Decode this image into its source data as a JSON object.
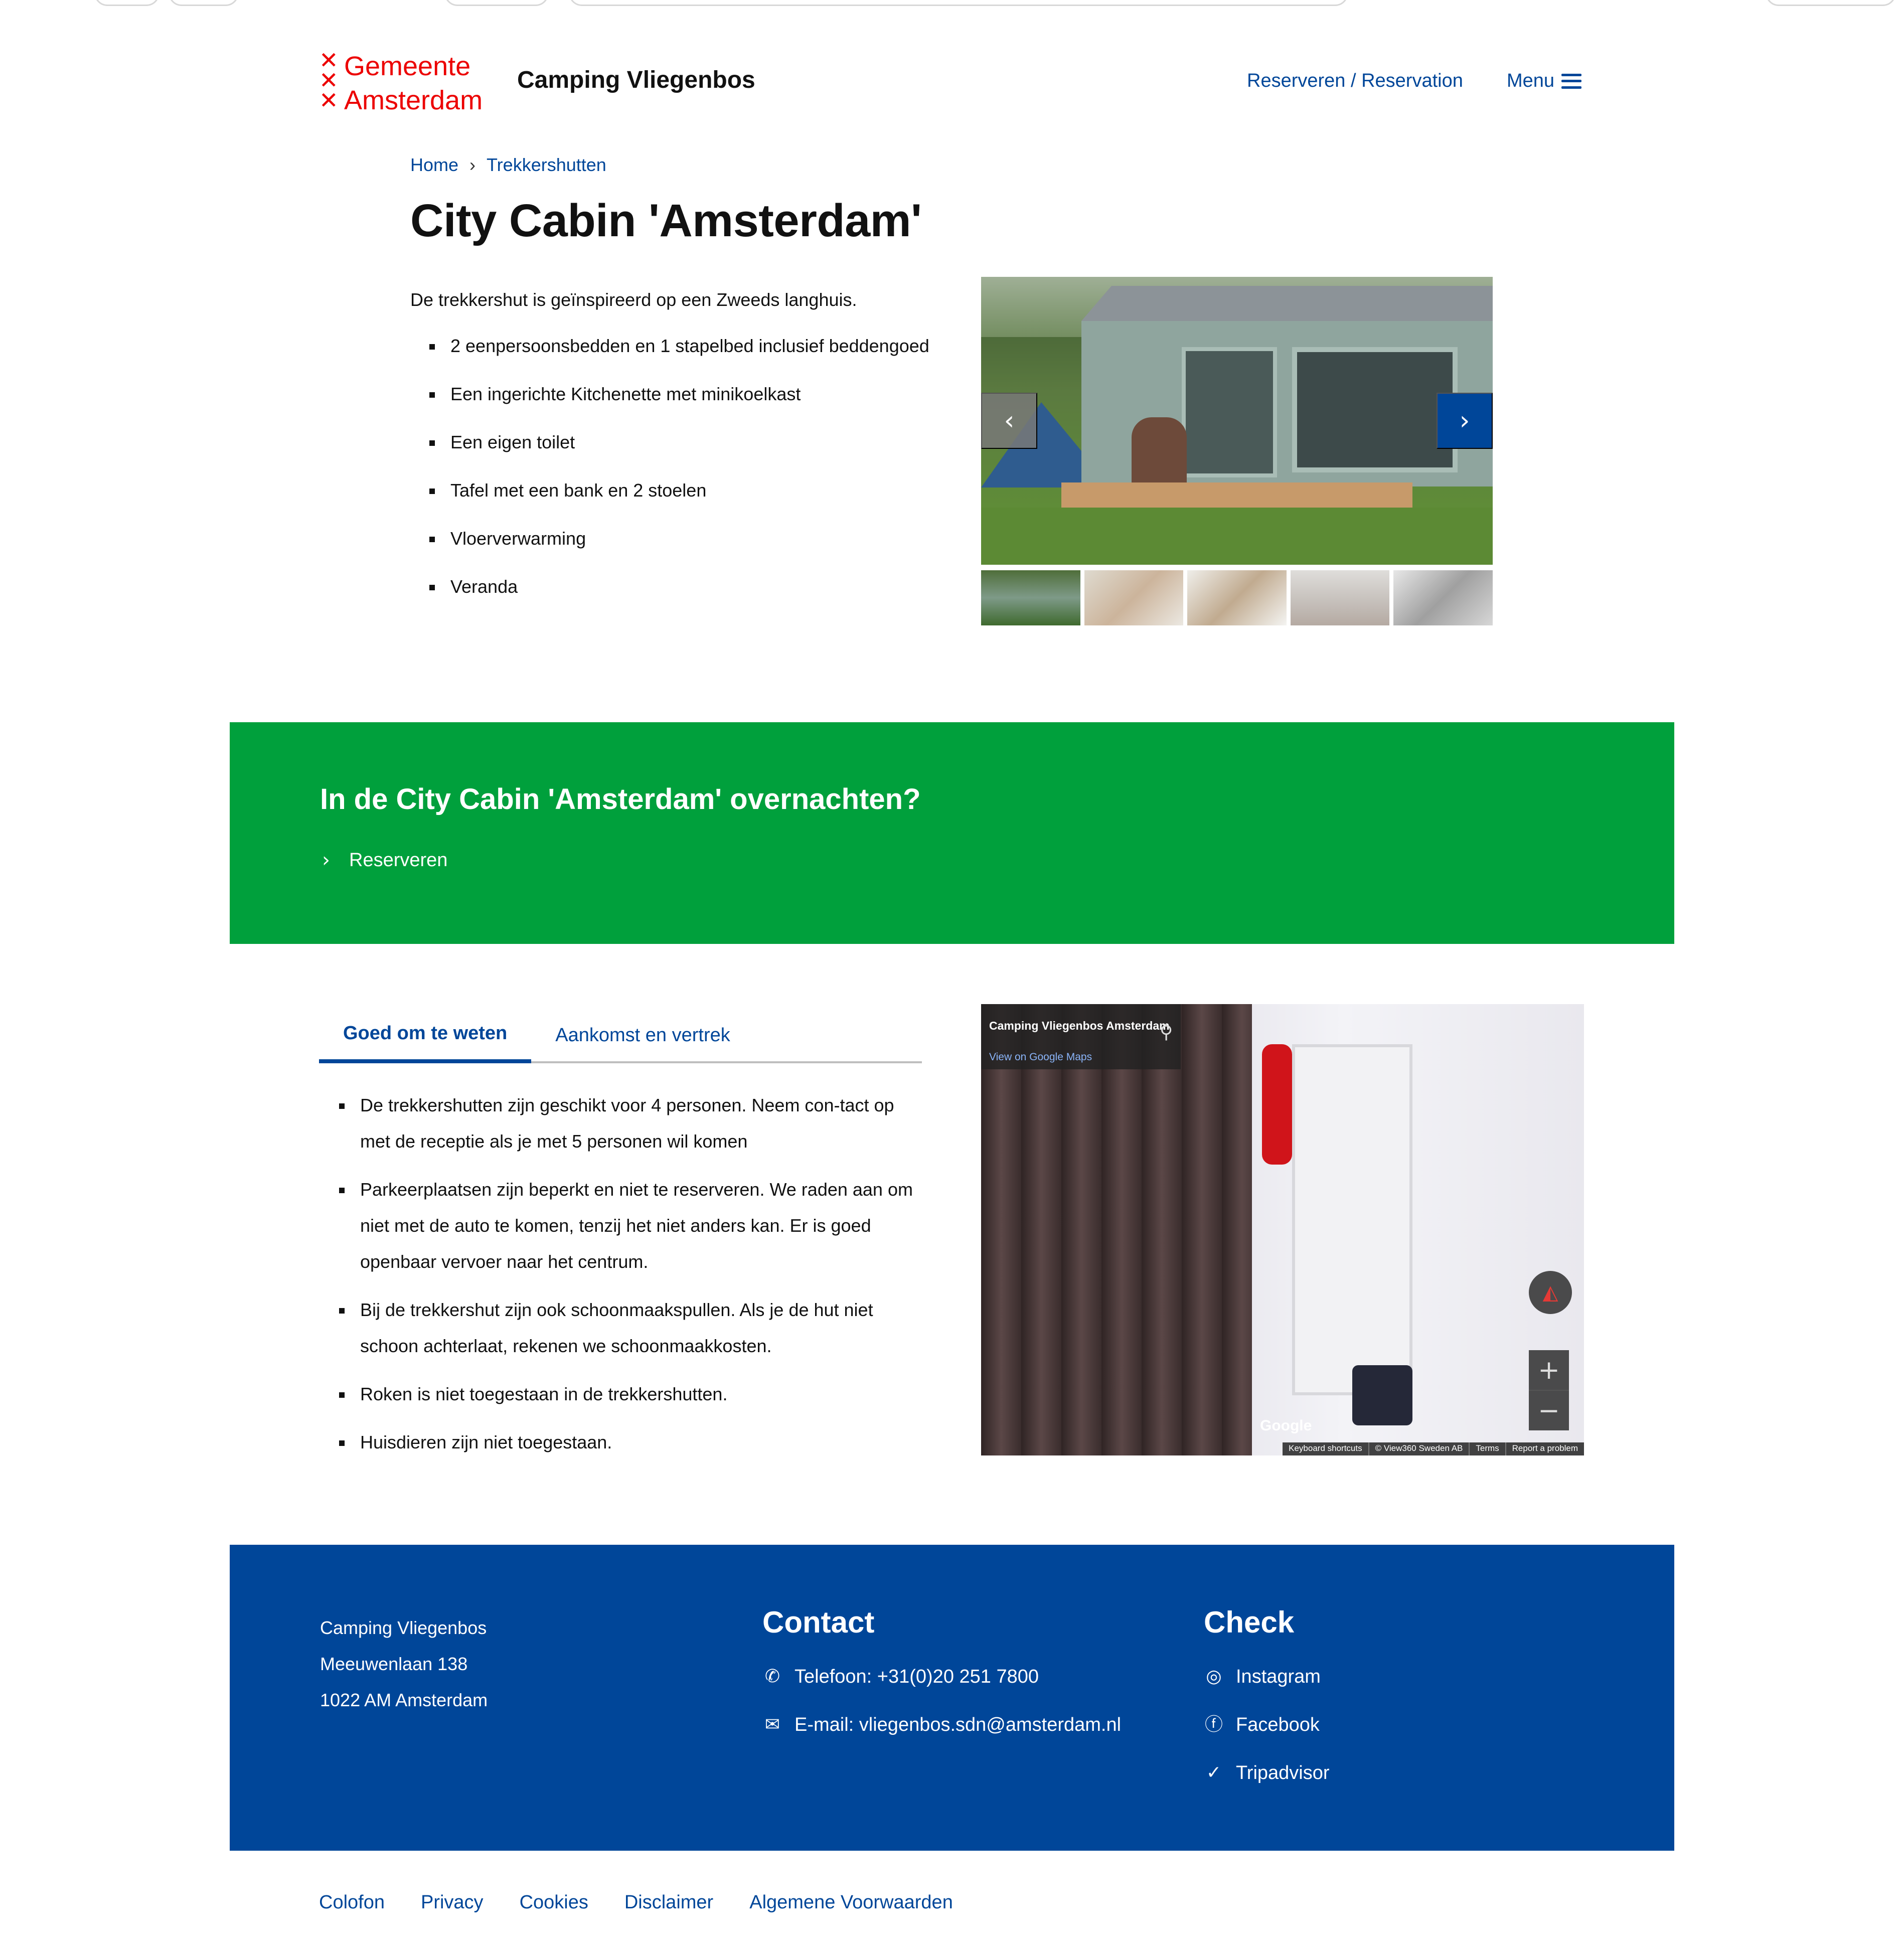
{
  "header": {
    "logo_text_line1": "Gemeente",
    "logo_text_line2": "Amsterdam",
    "site_name": "Camping Vliegenbos",
    "reserve_link": "Reserveren / Reservation",
    "menu_label": "Menu"
  },
  "breadcrumb": {
    "home": "Home",
    "separator": "›",
    "current": "Trekkershutten"
  },
  "page": {
    "title": "City Cabin 'Amsterdam'",
    "intro": "De trekkershut is geïnspireerd op een Zweeds langhuis.",
    "features": [
      "2 eenpersoonsbedden en 1 stapelbed inclusief beddengoed",
      "Een ingerichte Kitchenette met minikoelkast",
      "Een eigen toilet",
      "Tafel met een bank en 2 stoelen",
      "Vloerverwarming",
      "Veranda"
    ]
  },
  "carousel": {
    "prev_icon": "‹",
    "next_icon": "›"
  },
  "cta": {
    "heading": "In de City Cabin 'Amsterdam' overnachten?",
    "link_label": "Reserveren",
    "chevron": "›"
  },
  "tabs": {
    "items": [
      {
        "label": "Goed om te weten",
        "active": true
      },
      {
        "label": "Aankomst en vertrek",
        "active": false
      }
    ],
    "content": [
      "De trekkershutten zijn geschikt voor 4 personen. Neem con-tact op met de receptie als je met 5 personen wil komen",
      "Parkeerplaatsen zijn beperkt en niet te reserveren. We raden aan om niet met de auto te komen, tenzij het niet anders kan. Er is goed openbaar vervoer naar het centrum.",
      "Bij de trekkershut zijn ook schoonmaakspullen. Als je de hut niet schoon achterlaat, rekenen we schoonmaakkosten.",
      "Roken is niet toegestaan in de trekkershutten.",
      "Huisdieren zijn niet toegestaan."
    ]
  },
  "streetview": {
    "title": "Camping Vliegenbos Amsterdam",
    "maps_link": "View on Google Maps",
    "google_label": "Google",
    "zoom_in": "+",
    "zoom_out": "−",
    "attribution": [
      "Keyboard shortcuts",
      "© View360 Sweden AB",
      "Terms",
      "Report a problem"
    ]
  },
  "footer": {
    "address": [
      "Camping Vliegenbos",
      "Meeuwenlaan 138",
      "1022 AM Amsterdam"
    ],
    "contact_heading": "Contact",
    "phone": "Telefoon: +31(0)20 251 7800",
    "email": "E-mail: vliegenbos.sdn@amsterdam.nl",
    "check_heading": "Check",
    "socials": [
      "Instagram",
      "Facebook",
      "Tripadvisor"
    ]
  },
  "legal": [
    "Colofon",
    "Privacy",
    "Cookies",
    "Disclaimer",
    "Algemene Voorwaarden"
  ],
  "colors": {
    "brand_red": "#ec0000",
    "link_blue": "#004699",
    "cta_green": "#00a03c"
  }
}
